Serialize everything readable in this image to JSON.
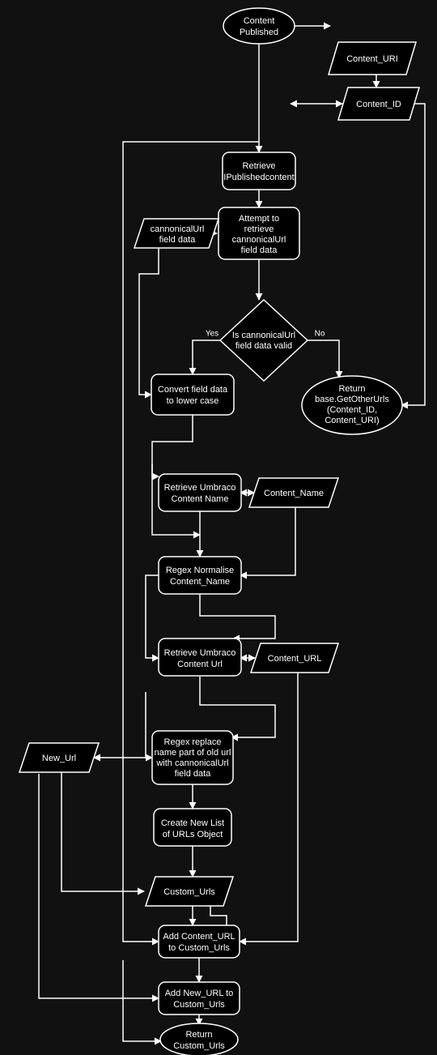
{
  "nodes": {
    "start": {
      "l1": "Content",
      "l2": "Published"
    },
    "uri": {
      "l1": "Content_URI"
    },
    "id": {
      "l1": "Content_ID"
    },
    "retrieve": {
      "l1": "Retrieve",
      "l2": "IPublishedcontent"
    },
    "attempt": {
      "l1": "Attempt to",
      "l2": "retrieve",
      "l3": "cannonicalUrl",
      "l4": "field data"
    },
    "canondata": {
      "l1": "cannonicalUrl",
      "l2": "field data"
    },
    "decision": {
      "l1": "Is cannonicalUrl",
      "l2": "field data valid"
    },
    "convert": {
      "l1": "Convert field data",
      "l2": "to lower case"
    },
    "returnbase": {
      "l1": "Return",
      "l2": "base.GetOtherUrls",
      "l3": "(Content_ID,",
      "l4": "Content_URI)"
    },
    "retrievename": {
      "l1": "Retrieve Umbraco",
      "l2": "Content Name"
    },
    "contentname": {
      "l1": "Content_Name"
    },
    "regexnorm": {
      "l1": "Regex Normalise",
      "l2": "Content_Name"
    },
    "retrieveurl": {
      "l1": "Retrieve Umbraco",
      "l2": "Content Url"
    },
    "contenturl": {
      "l1": "Content_URL"
    },
    "replace": {
      "l1": "Regex replace",
      "l2": "name part of old url",
      "l3": "with cannonicalUrl",
      "l4": "field data"
    },
    "newurl": {
      "l1": "New_Url"
    },
    "createlist": {
      "l1": "Create New List",
      "l2": "of URLs Object"
    },
    "customurls": {
      "l1": "Custom_Urls"
    },
    "addcontent": {
      "l1": "Add Content_URL",
      "l2": "to Custom_Urls"
    },
    "addnew": {
      "l1": "Add New_URL to",
      "l2": "Custom_Urls"
    },
    "returncustom": {
      "l1": "Return",
      "l2": "Custom_Urls"
    }
  },
  "edges": {
    "yes": "Yes",
    "no": "No"
  }
}
